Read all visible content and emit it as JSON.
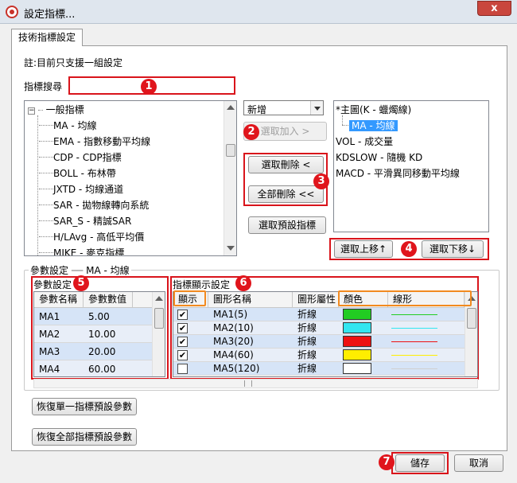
{
  "window": {
    "title": "設定指標...",
    "close_glyph": "x"
  },
  "tab": {
    "label": "技術指標設定"
  },
  "note": "註:目前只支援一組設定",
  "search": {
    "label": "指標搜尋",
    "value": ""
  },
  "badges": [
    "1",
    "2",
    "3",
    "4",
    "5",
    "6",
    "7"
  ],
  "tree": {
    "root_label": "一般指標",
    "items": [
      "MA - 均線",
      "EMA - 指數移動平均線",
      "CDP - CDP指標",
      "BOLL - 布林帶",
      "JXTD - 均線通道",
      "SAR - 拋物線轉向系統",
      "SAR_S - 精誠SAR",
      "H/LAvg - 高低平均價",
      "MIKE - 麥克指標"
    ]
  },
  "action": {
    "select_value": "新增",
    "add_label": "選取加入 >",
    "remove_label": "選取刪除 <",
    "remove_all_label": "全部刪除 <<",
    "preset_label": "選取預設指標"
  },
  "selected_list": {
    "items": [
      {
        "label": "*主圖(K - 蠟燭線)",
        "indent": 0,
        "selected": false
      },
      {
        "label": "MA - 均線",
        "indent": 1,
        "selected": true
      },
      {
        "label": "VOL - 成交量",
        "indent": 0,
        "selected": false
      },
      {
        "label": "KDSLOW - 隨機 KD",
        "indent": 0,
        "selected": false
      },
      {
        "label": "MACD - 平滑異同移動平均線",
        "indent": 0,
        "selected": false
      }
    ]
  },
  "move": {
    "up_label": "選取上移↑",
    "down_label": "選取下移↓"
  },
  "params_group": {
    "title": "參數設定",
    "subject": "MA - 均線"
  },
  "params": {
    "title": "參數設定",
    "headers": [
      "參數名稱",
      "參數數值"
    ],
    "rows": [
      [
        "MA1",
        "5.00"
      ],
      [
        "MA2",
        "10.00"
      ],
      [
        "MA3",
        "20.00"
      ],
      [
        "MA4",
        "60.00"
      ]
    ]
  },
  "display": {
    "title": "指標顯示設定",
    "headers": [
      "顯示",
      "圖形名稱",
      "圖形屬性",
      "顏色",
      "線形"
    ],
    "rows": [
      {
        "checked": true,
        "name": "MA1(5)",
        "attr": "折線",
        "color": "#22cc22",
        "line": "#22cc22"
      },
      {
        "checked": true,
        "name": "MA2(10)",
        "attr": "折線",
        "color": "#33e6f0",
        "line": "#33e6f0"
      },
      {
        "checked": true,
        "name": "MA3(20)",
        "attr": "折線",
        "color": "#ee1111",
        "line": "#ee1111"
      },
      {
        "checked": true,
        "name": "MA4(60)",
        "attr": "折線",
        "color": "#ffee00",
        "line": "#ffee00"
      },
      {
        "checked": false,
        "name": "MA5(120)",
        "attr": "折線",
        "color": "#ffffff",
        "line": "#cfcfcf"
      }
    ]
  },
  "restore_single_label": "恢復單一指標預設參數",
  "restore_all_label": "恢復全部指標預設參數",
  "footer": {
    "save_label": "儲存",
    "cancel_label": "取消"
  }
}
